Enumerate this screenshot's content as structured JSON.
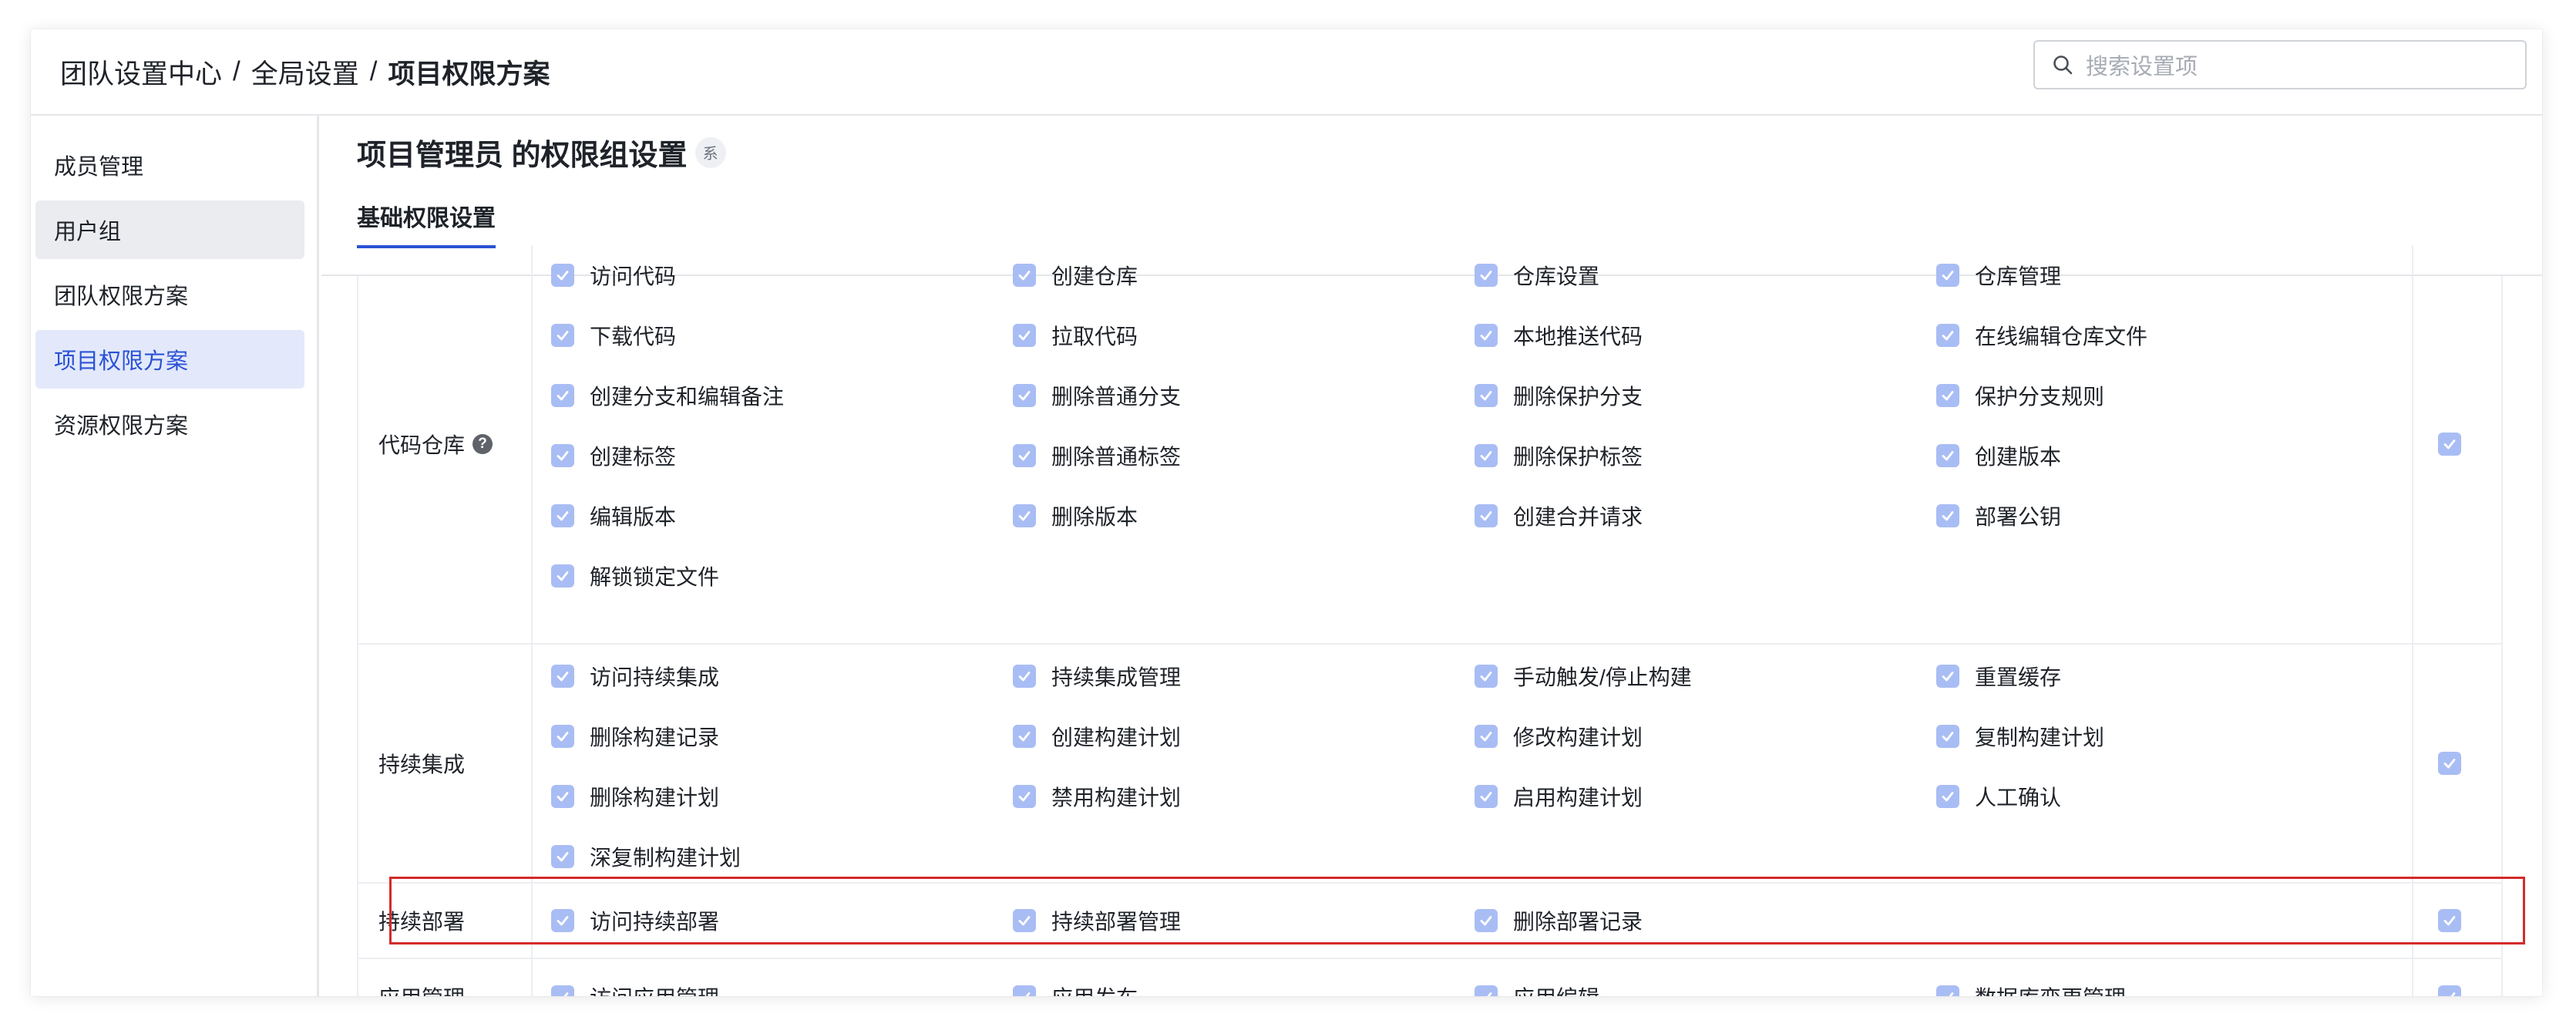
{
  "breadcrumb": {
    "items": [
      "团队设置中心",
      "全局设置",
      "项目权限方案"
    ],
    "separator": "/"
  },
  "search": {
    "placeholder": "搜索设置项",
    "icon": "search-icon"
  },
  "sidebar": {
    "items": [
      {
        "label": "成员管理",
        "state": "normal"
      },
      {
        "label": "用户组",
        "state": "hover"
      },
      {
        "label": "团队权限方案",
        "state": "normal"
      },
      {
        "label": "项目权限方案",
        "state": "active"
      },
      {
        "label": "资源权限方案",
        "state": "normal"
      }
    ]
  },
  "main": {
    "title": "项目管理员 的权限组设置",
    "title_tag": "系",
    "tab": "基础权限设置"
  },
  "groups": [
    {
      "label": "代码仓库",
      "help_icon": "?",
      "permissions": [
        "访问代码",
        "创建仓库",
        "仓库设置",
        "仓库管理",
        "下载代码",
        "拉取代码",
        "本地推送代码",
        "在线编辑仓库文件",
        "创建分支和编辑备注",
        "删除普通分支",
        "删除保护分支",
        "保护分支规则",
        "创建标签",
        "删除普通标签",
        "删除保护标签",
        "创建版本",
        "编辑版本",
        "删除版本",
        "创建合并请求",
        "部署公钥",
        "解锁锁定文件"
      ]
    },
    {
      "label": "持续集成",
      "permissions": [
        "访问持续集成",
        "持续集成管理",
        "手动触发/停止构建",
        "重置缓存",
        "删除构建记录",
        "创建构建计划",
        "修改构建计划",
        "复制构建计划",
        "删除构建计划",
        "禁用构建计划",
        "启用构建计划",
        "人工确认",
        "深复制构建计划"
      ]
    },
    {
      "label": "持续部署",
      "permissions": [
        "访问持续部署",
        "持续部署管理",
        "删除部署记录"
      ]
    },
    {
      "label": "应用管理",
      "permissions": [
        "访问应用管理",
        "应用发布",
        "应用编辑",
        "数据库变更管理"
      ]
    }
  ],
  "colors": {
    "accent": "#2b52d4",
    "checkbox": "#a9bdf5",
    "highlight": "#d42b2b"
  }
}
